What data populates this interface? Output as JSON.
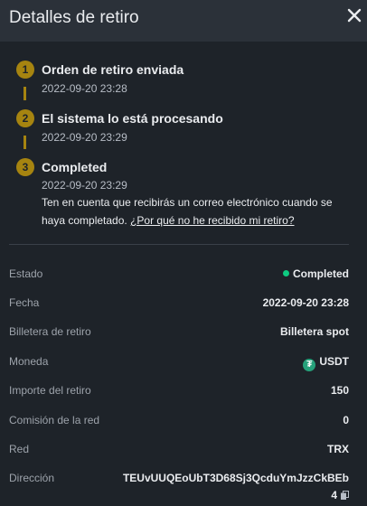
{
  "header": {
    "title": "Detalles de retiro"
  },
  "steps": [
    {
      "number": "1",
      "title": "Orden de retiro enviada",
      "time": "2022-09-20 23:28"
    },
    {
      "number": "2",
      "title": "El sistema lo está procesando",
      "time": "2022-09-20 23:29"
    },
    {
      "number": "3",
      "title": "Completed",
      "time": "2022-09-20 23:29"
    }
  ],
  "note": {
    "text": "Ten en cuenta que recibirás un correo electrónico cuando se haya completado.",
    "link": "¿Por qué no he recibido mi retiro?"
  },
  "details": {
    "status": {
      "label": "Estado",
      "value": "Completed"
    },
    "date": {
      "label": "Fecha",
      "value": "2022-09-20 23:28"
    },
    "wallet": {
      "label": "Billetera de retiro",
      "value": "Billetera spot"
    },
    "coin": {
      "label": "Moneda",
      "value": "USDT"
    },
    "amount": {
      "label": "Importe del retiro",
      "value": "150"
    },
    "fee": {
      "label": "Comisión de la red",
      "value": "0"
    },
    "network": {
      "label": "Red",
      "value": "TRX"
    },
    "address": {
      "label": "Dirección",
      "line1": "TEUvUUQEoUbT3D68Sj3QcduYmJzzCkBEb",
      "line2": "4"
    }
  },
  "colors": {
    "background": "#1e2329",
    "header_bg": "#2b3139",
    "accent": "#a68410",
    "success": "#0ecb81",
    "tether": "#26a17b"
  },
  "icons": {
    "close": "close-icon",
    "coin": "usdt-icon",
    "copy": "copy-icon",
    "status": "status-dot-icon"
  }
}
